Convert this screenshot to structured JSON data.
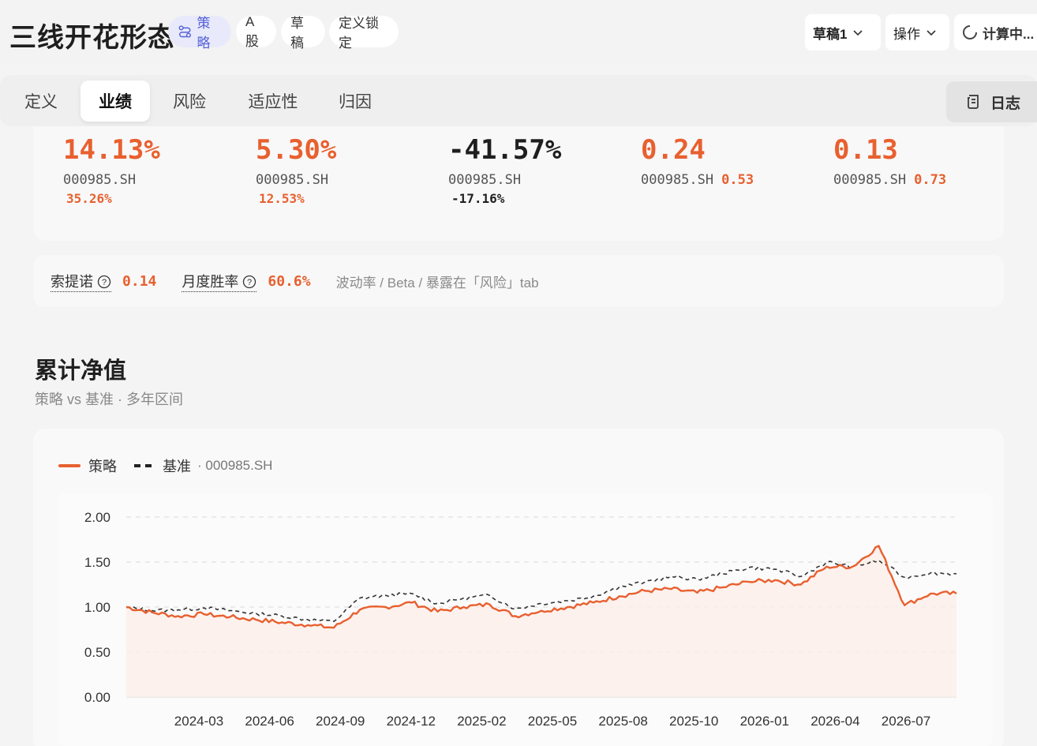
{
  "header": {
    "title": "三线开花形态",
    "chips": {
      "strategy": "策略",
      "market": "A股",
      "draft": "草稿",
      "lock": "定义锁定"
    },
    "draft_select": "草稿1",
    "ops_label": "操作",
    "calc_label": "计算中..."
  },
  "tabs": {
    "def": "定义",
    "perf": "业绩",
    "risk": "风险",
    "fit": "适应性",
    "attr": "归因",
    "log": "日志"
  },
  "metrics": [
    {
      "value": "14.13%",
      "bench_code": "000985.SH",
      "bench_value": "35.26%",
      "value_color": "#e8602f",
      "bench_color": "#e8602f"
    },
    {
      "value": "5.30%",
      "bench_code": "000985.SH",
      "bench_value": "12.53%",
      "value_color": "#e8602f",
      "bench_color": "#e8602f"
    },
    {
      "value": "-41.57%",
      "bench_code": "000985.SH",
      "bench_value": "-17.16%",
      "value_color": "#1f1f1f",
      "bench_color": "#1f1f1f"
    },
    {
      "value": "0.24",
      "bench_code": "000985.SH",
      "bench_value": "0.53",
      "value_color": "#e8602f",
      "bench_color": "#e8602f"
    },
    {
      "value": "0.13",
      "bench_code": "000985.SH",
      "bench_value": "0.73",
      "value_color": "#e8602f",
      "bench_color": "#e8602f"
    }
  ],
  "info": {
    "sortino_label": "索提诺",
    "sortino_value": "0.14",
    "winrate_label": "月度胜率",
    "winrate_value": "60.6%",
    "note": "波动率 / Beta / 暴露在「风险」tab"
  },
  "section": {
    "title": "累计净值",
    "subtitle": "策略 vs 基准 · 多年区间"
  },
  "legend": {
    "strategy": "策略",
    "benchmark": "基准",
    "benchmark_code": "· 000985.SH"
  },
  "colors": {
    "accent": "#e8602f",
    "benchmark": "#333333",
    "fill": "#fdeeea"
  },
  "chart_data": {
    "type": "line",
    "title": "",
    "xlabel": "",
    "ylabel": "",
    "ylim": [
      0,
      2
    ],
    "yticks": [
      "0.00",
      "0.50",
      "1.00",
      "1.50",
      "2.00"
    ],
    "xticks": [
      "2024-03",
      "2024-06",
      "2024-09",
      "2024-12",
      "2025-02",
      "2025-05",
      "2025-08",
      "2025-10",
      "2026-01",
      "2026-04",
      "2026-07"
    ],
    "x": [
      "2024-01",
      "2024-02",
      "2024-03",
      "2024-04",
      "2024-05",
      "2024-06",
      "2024-07",
      "2024-08",
      "2024-09",
      "2024-10",
      "2024-11",
      "2024-12",
      "2025-01",
      "2025-02",
      "2025-03",
      "2025-04",
      "2025-05",
      "2025-06",
      "2025-07",
      "2025-08",
      "2025-09",
      "2025-10",
      "2025-11",
      "2025-12",
      "2026-01",
      "2026-02",
      "2026-03",
      "2026-04",
      "2026-05",
      "2026-06",
      "2026-07",
      "2026-08",
      "2026-09"
    ],
    "series": [
      {
        "name": "策略",
        "style": "solid",
        "values": [
          1.0,
          0.94,
          0.9,
          0.92,
          0.89,
          0.86,
          0.83,
          0.8,
          0.77,
          0.97,
          1.0,
          1.05,
          0.95,
          1.0,
          1.03,
          0.9,
          0.96,
          1.0,
          1.05,
          1.12,
          1.18,
          1.2,
          1.16,
          1.22,
          1.28,
          1.3,
          1.25,
          1.45,
          1.45,
          1.68,
          1.02,
          1.15,
          1.15
        ]
      },
      {
        "name": "基准",
        "style": "dash",
        "values": [
          1.0,
          0.96,
          0.97,
          0.99,
          0.96,
          0.93,
          0.9,
          0.86,
          0.84,
          1.1,
          1.13,
          1.15,
          1.04,
          1.1,
          1.13,
          0.98,
          1.04,
          1.07,
          1.12,
          1.22,
          1.28,
          1.34,
          1.31,
          1.37,
          1.44,
          1.42,
          1.34,
          1.5,
          1.45,
          1.52,
          1.33,
          1.38,
          1.37
        ]
      }
    ]
  }
}
